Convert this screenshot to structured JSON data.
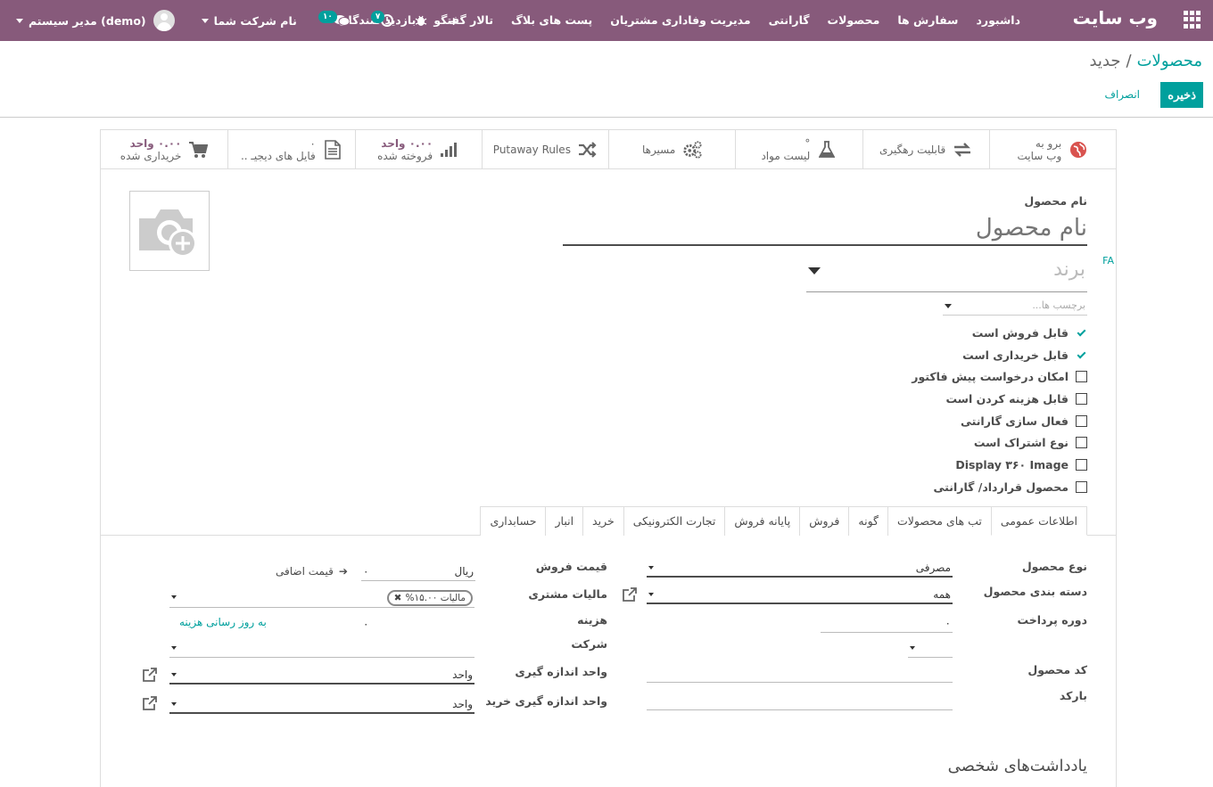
{
  "navbar": {
    "brand": "وب سایت",
    "menu": [
      "داشبورد",
      "سفارش ها",
      "محصولات",
      "گارانتی",
      "مدیریت وفاداری مشتریان",
      "پست های بلاگ",
      "تالار گفتگو",
      "بازدید کنندگان"
    ],
    "company": "نام شرکت شما",
    "user": "مدیر سیستم (demo)",
    "messages_count": "۱۰",
    "activities_count": "۷",
    "plus": "+"
  },
  "control": {
    "breadcrumb_parent": "محصولات",
    "breadcrumb_sep": "/",
    "breadcrumb_current": "جدید",
    "save": "ذخیره",
    "discard": "انصراف"
  },
  "smart_buttons": [
    {
      "line1": "برو به",
      "line2": "وب سایت",
      "icon": "globe-icon",
      "num": ""
    },
    {
      "line1": "قابلیت رهگیری",
      "line2": "",
      "icon": "exchange-icon",
      "num": ""
    },
    {
      "line1": "°",
      "line2": "لیست مواد",
      "icon": "flask-icon",
      "num": ""
    },
    {
      "line1": "مسیرها",
      "line2": "",
      "icon": "cogs-icon",
      "num": ""
    },
    {
      "line1": "Putaway Rules",
      "line2": "",
      "icon": "random-icon",
      "num": ""
    },
    {
      "line1": "۰.۰۰ واحد",
      "line2": "فروخته شده",
      "icon": "chart-icon",
      "num": "yes"
    },
    {
      "line1": "۰",
      "line2": "فایل های دیجیـ ..",
      "icon": "file-icon",
      "num": ""
    },
    {
      "line1": "۰.۰۰ واحد",
      "line2": "خریداری شده",
      "icon": "cart-icon",
      "num": "yes"
    }
  ],
  "product": {
    "name_label": "نام محصول",
    "name_placeholder": "نام محصول",
    "lang": "FA",
    "brand_placeholder": "برند",
    "tags_placeholder": "برچسب ها..."
  },
  "checkboxes": [
    {
      "label": "قابل فروش است",
      "checked": true
    },
    {
      "label": "قابل خریداری است",
      "checked": true
    },
    {
      "label": "امکان درخواست پیش فاکتور",
      "checked": false
    },
    {
      "label": "قابل هزینه کردن است",
      "checked": false
    },
    {
      "label": "فعال سازی گارانتی",
      "checked": false
    },
    {
      "label": "نوع اشتراک است",
      "checked": false
    },
    {
      "label": "Display ۳۶۰ Image",
      "checked": false
    },
    {
      "label": "محصول قرارداد/ گارانتی",
      "checked": false
    }
  ],
  "tabs": [
    "اطلاعات عمومی",
    "تب های محصولات",
    "گونه",
    "فروش",
    "پایانه فروش",
    "تجارت الکترونیکی",
    "خرید",
    "انبار",
    "حسابداری"
  ],
  "general": {
    "product_type_label": "نوع محصول",
    "product_type_value": "مصرفی",
    "category_label": "دسته بندی محصول",
    "category_value": "همه",
    "payment_period_label": "دوره پرداخت",
    "payment_period_value": "۰",
    "code_label": "کد محصول",
    "barcode_label": "بارکد",
    "sale_price_label": "قیمت فروش",
    "sale_price_value": "۰",
    "currency": "ریال",
    "extra_price": "قیمت اضافی",
    "customer_tax_label": "مالیات مشتری",
    "tax_tag": "مالیات ۱۵.۰۰%",
    "cost_label": "هزینه",
    "cost_value": "۰",
    "update_cost": "به روز رسانی هزینه",
    "company_label": "شرکت",
    "uom_label": "واحد اندازه گیری",
    "uom_value": "واحد",
    "purchase_uom_label": "واحد اندازه گیری خرید",
    "purchase_uom_value": "واحد"
  },
  "notes_title": "یادداشت‌های شخصی",
  "colors": {
    "primary": "#875a7b",
    "accent": "#00a09d"
  }
}
